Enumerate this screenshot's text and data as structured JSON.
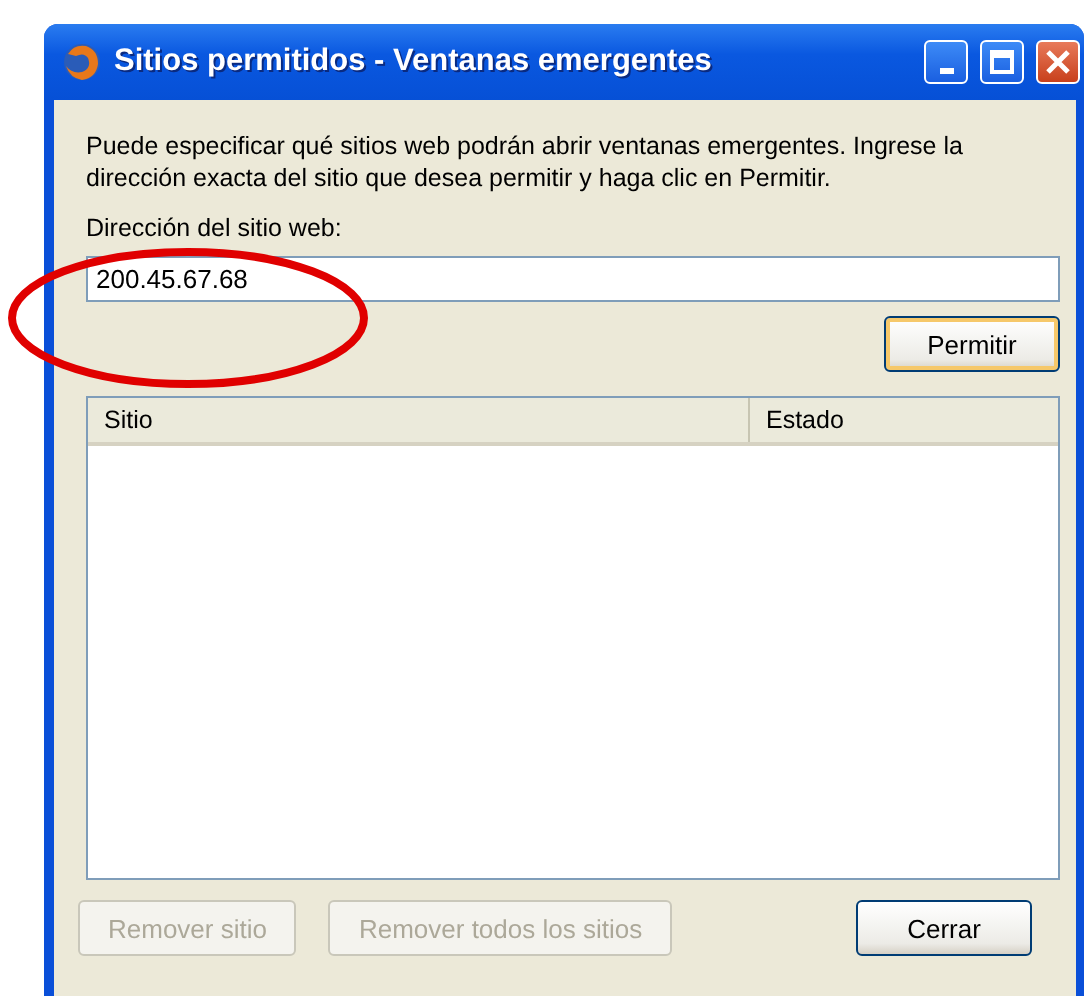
{
  "window": {
    "title": "Sitios permitidos - Ventanas emergentes"
  },
  "description": "Puede especificar qué sitios web podrán abrir ventanas emergentes. Ingrese la dirección exacta del sitio que desea permitir y haga clic en Permitir.",
  "address": {
    "label": "Dirección del sitio web:",
    "value": "200.45.67.68"
  },
  "allow_button": {
    "label": "Permitir",
    "disabled": false
  },
  "table": {
    "columns": [
      "Sitio",
      "Estado"
    ]
  },
  "buttons": [
    {
      "label": "Remover sitio",
      "disabled": true
    },
    {
      "label": "Remover todos los sitios",
      "disabled": true
    },
    {
      "label": "Cerrar",
      "disabled": false
    }
  ]
}
